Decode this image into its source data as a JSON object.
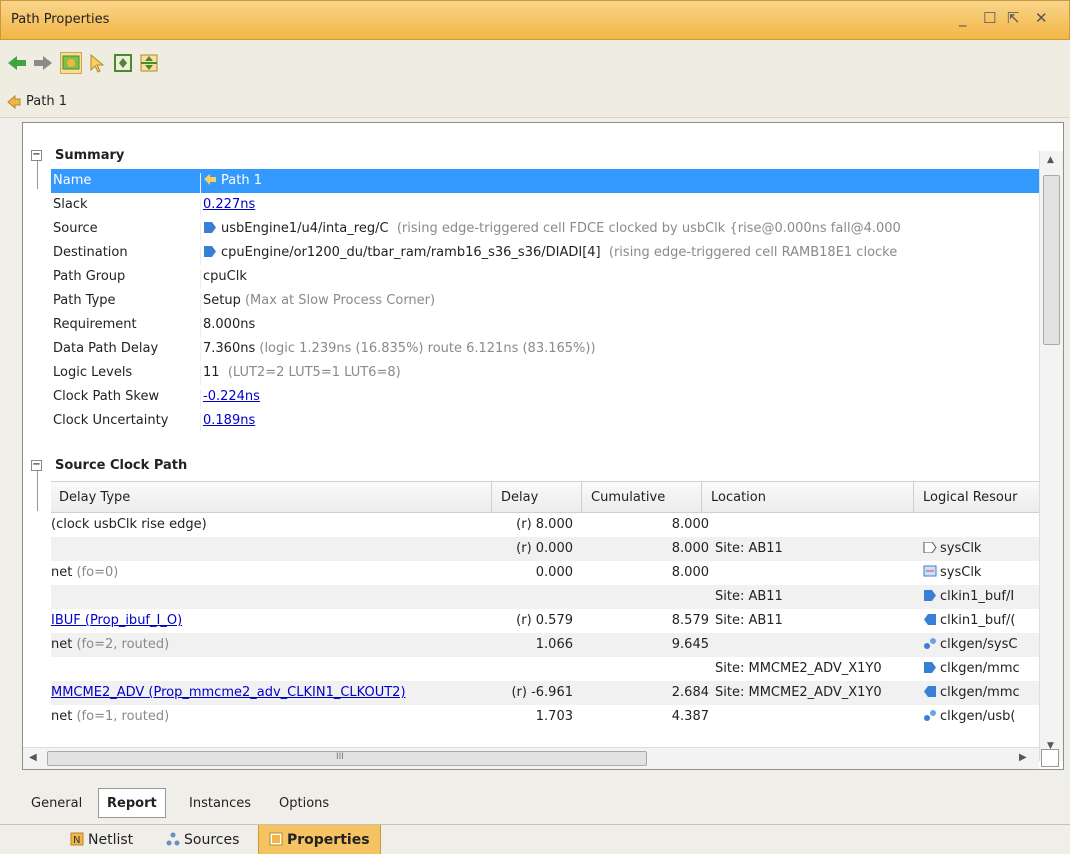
{
  "window": {
    "title": "Path Properties",
    "controls": {
      "minimize": "_",
      "maximize": "☐",
      "float": "⇱",
      "close": "✕"
    }
  },
  "path_label": "Path 1",
  "summary": {
    "header": "Summary",
    "rows": [
      {
        "key": "Name",
        "value": "Path 1"
      },
      {
        "key": "Slack",
        "value": "0.227ns"
      },
      {
        "key": "Source",
        "value": "usbEngine1/u4/inta_reg/C",
        "extra": "(rising edge-triggered cell FDCE clocked by usbClk  {rise@0.000ns fall@4.000"
      },
      {
        "key": "Destination",
        "value": "cpuEngine/or1200_du/tbar_ram/ramb16_s36_s36/DIADI[4]",
        "extra": "(rising edge-triggered cell RAMB18E1 clocke"
      },
      {
        "key": "Path Group",
        "value": "cpuClk"
      },
      {
        "key": "Path Type",
        "value": "Setup",
        "extra": "(Max at Slow Process Corner)"
      },
      {
        "key": "Requirement",
        "value": "8.000ns"
      },
      {
        "key": "Data Path Delay",
        "value": "7.360ns",
        "extra": "(logic 1.239ns (16.835%)  route 6.121ns (83.165%))"
      },
      {
        "key": "Logic Levels",
        "value": "11",
        "extra": "(LUT2=2 LUT5=1 LUT6=8)"
      },
      {
        "key": "Clock Path Skew",
        "value": "-0.224ns"
      },
      {
        "key": "Clock Uncertainty",
        "value": "0.189ns"
      }
    ]
  },
  "source_clock": {
    "header": "Source Clock Path",
    "columns": [
      "Delay Type",
      "Delay",
      "Cumulative",
      "Location",
      "Logical Resour"
    ],
    "rows": [
      {
        "type": "(clock usbClk rise edge)",
        "type_extra": "",
        "delay": "(r) 8.000",
        "cum": "8.000",
        "loc": "",
        "res": ""
      },
      {
        "type": "",
        "type_extra": "",
        "delay": "(r) 0.000",
        "cum": "8.000",
        "loc": "Site: AB11",
        "res": "sysClk"
      },
      {
        "type": "net",
        "type_extra": "(fo=0)",
        "delay": "0.000",
        "cum": "8.000",
        "loc": "",
        "res": "sysClk"
      },
      {
        "type": "",
        "type_extra": "",
        "delay": "",
        "cum": "",
        "loc": "Site: AB11",
        "res": "clkin1_buf/I"
      },
      {
        "type": "IBUF (Prop_ibuf_I_O)",
        "type_extra": "",
        "delay": "(r) 0.579",
        "cum": "8.579",
        "loc": "Site: AB11",
        "res": "clkin1_buf/("
      },
      {
        "type": "net",
        "type_extra": "(fo=2, routed)",
        "delay": "1.066",
        "cum": "9.645",
        "loc": "",
        "res": "clkgen/sysC"
      },
      {
        "type": "",
        "type_extra": "",
        "delay": "",
        "cum": "",
        "loc": "Site: MMCME2_ADV_X1Y0",
        "res": "clkgen/mmc"
      },
      {
        "type": "MMCME2_ADV (Prop_mmcme2_adv_CLKIN1_CLKOUT2)",
        "type_extra": "",
        "delay": "(r) -6.961",
        "cum": "2.684",
        "loc": "Site: MMCME2_ADV_X1Y0",
        "res": "clkgen/mmc"
      },
      {
        "type": "net",
        "type_extra": "(fo=1, routed)",
        "delay": "1.703",
        "cum": "4.387",
        "loc": "",
        "res": "clkgen/usb("
      }
    ]
  },
  "scroll": {
    "hscroll_mark": "III"
  },
  "bottom_tabs": [
    "General",
    "Report",
    "Instances",
    "Options"
  ],
  "dock_tabs": [
    "Netlist",
    "Sources",
    "Properties"
  ],
  "colors": {
    "accent": "#f3b646",
    "selection": "#3399ff",
    "link": "#0000cc"
  }
}
